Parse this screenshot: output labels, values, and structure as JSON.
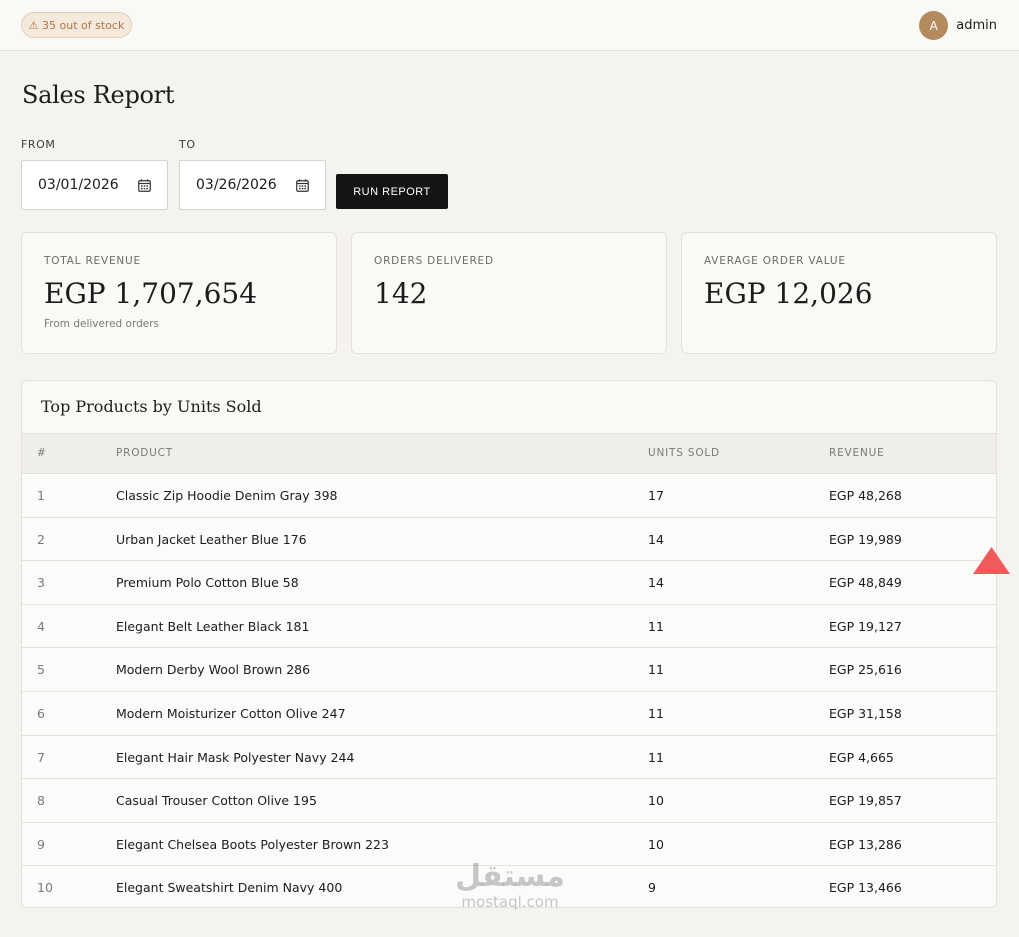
{
  "header": {
    "stock_alert": "⚠ 35 out of stock",
    "user": {
      "avatar_initial": "A",
      "name": "admin"
    }
  },
  "page": {
    "title": "Sales Report"
  },
  "filters": {
    "from_label": "FROM",
    "from_value": "03/01/2026",
    "to_label": "TO",
    "to_value": "03/26/2026",
    "run_button": "RUN REPORT"
  },
  "stats": [
    {
      "label": "TOTAL REVENUE",
      "value": "EGP 1,707,654",
      "sub": "From delivered orders"
    },
    {
      "label": "ORDERS DELIVERED",
      "value": "142",
      "sub": ""
    },
    {
      "label": "AVERAGE ORDER VALUE",
      "value": "EGP 12,026",
      "sub": ""
    }
  ],
  "top_products": {
    "title": "Top Products by Units Sold",
    "columns": [
      "#",
      "PRODUCT",
      "UNITS SOLD",
      "REVENUE"
    ],
    "rows": [
      {
        "rank": "1",
        "product": "Classic Zip Hoodie Denim Gray 398",
        "units": "17",
        "revenue": "EGP 48,268"
      },
      {
        "rank": "2",
        "product": "Urban Jacket Leather Blue 176",
        "units": "14",
        "revenue": "EGP 19,989"
      },
      {
        "rank": "3",
        "product": "Premium Polo Cotton Blue 58",
        "units": "14",
        "revenue": "EGP 48,849"
      },
      {
        "rank": "4",
        "product": "Elegant Belt Leather Black 181",
        "units": "11",
        "revenue": "EGP 19,127"
      },
      {
        "rank": "5",
        "product": "Modern Derby Wool Brown 286",
        "units": "11",
        "revenue": "EGP 25,616"
      },
      {
        "rank": "6",
        "product": "Modern Moisturizer Cotton Olive 247",
        "units": "11",
        "revenue": "EGP 31,158"
      },
      {
        "rank": "7",
        "product": "Elegant Hair Mask Polyester Navy 244",
        "units": "11",
        "revenue": "EGP 4,665"
      },
      {
        "rank": "8",
        "product": "Casual Trouser Cotton Olive 195",
        "units": "10",
        "revenue": "EGP 19,857"
      },
      {
        "rank": "9",
        "product": "Elegant Chelsea Boots Polyester Brown 223",
        "units": "10",
        "revenue": "EGP 13,286"
      },
      {
        "rank": "10",
        "product": "Elegant Sweatshirt Denim Navy 400",
        "units": "9",
        "revenue": "EGP 13,466"
      }
    ]
  },
  "watermark": {
    "arabic": "مستقل",
    "latin": "mostaql.com"
  },
  "icons": {
    "calendar": "calendar-icon",
    "warning": "warning-icon",
    "scroll_top": "arrow-up-icon"
  },
  "colors": {
    "accent_badge": "#b0764a",
    "avatar": "#b38b5e",
    "button": "#141414",
    "scroll_top": "#ef5a5a"
  }
}
